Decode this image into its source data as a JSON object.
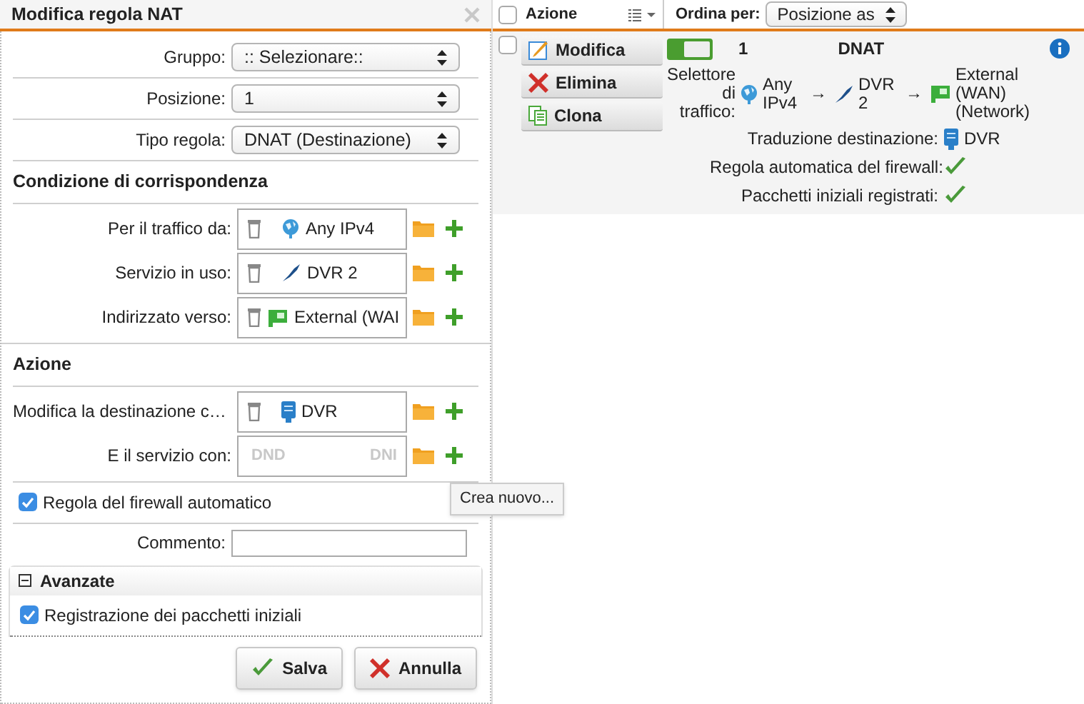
{
  "dialog": {
    "title": "Modifica regola NAT",
    "selects": [
      {
        "label": "Gruppo:",
        "value": ":: Selezionare::"
      },
      {
        "label": "Posizione:",
        "value": "1"
      },
      {
        "label": "Tipo regola:",
        "value": "DNAT (Destinazione)"
      }
    ],
    "match_section": {
      "title": "Condizione di corrispondenza",
      "rows": [
        {
          "label": "Per il traffico da:",
          "item": "Any IPv4",
          "kind": "network"
        },
        {
          "label": "Servizio in uso:",
          "item": "DVR 2",
          "kind": "service"
        },
        {
          "label": "Indirizzato verso:",
          "item": "External (WAI",
          "kind": "interface"
        }
      ]
    },
    "action_section": {
      "title": "Azione",
      "rows": [
        {
          "label": "Modifica la destinazione c…",
          "item": "DVR",
          "kind": "host"
        },
        {
          "label": "E il servizio con:",
          "hints": [
            "DND",
            "DNI"
          ],
          "kind": "empty"
        }
      ]
    },
    "auto_firewall": {
      "label": "Regola del firewall automatico",
      "checked": true
    },
    "comment": {
      "label": "Commento:"
    },
    "advanced": {
      "title": "Avanzate",
      "expanded": true,
      "log": {
        "label": "Registrazione dei pacchetti iniziali",
        "checked": true
      }
    },
    "buttons": [
      {
        "label": "Salva",
        "kind": "save"
      },
      {
        "label": "Annulla",
        "kind": "cancel"
      }
    ]
  },
  "tooltip": "Crea nuovo...",
  "list": {
    "header": {
      "action": "Azione",
      "sort_label": "Ordina per:",
      "sort_value": "Posizione as",
      "checked": false
    },
    "rules": [
      {
        "checked": false,
        "enabled": true,
        "number": "1",
        "type": "DNAT",
        "buttons": [
          {
            "label": "Modifica",
            "kind": "edit"
          },
          {
            "label": "Elimina",
            "kind": "delete"
          },
          {
            "label": "Clona",
            "kind": "clone"
          }
        ],
        "selector_label": "Selettore di traffico:",
        "separator": "→",
        "chain": [
          {
            "text": "Any IPv4",
            "kind": "network"
          },
          {
            "text": "DVR 2",
            "kind": "service"
          },
          {
            "text": "External (WAN) (Network)",
            "kind": "interface"
          }
        ],
        "translation": {
          "label": "Traduzione destinazione:",
          "item": "DVR",
          "kind": "host"
        },
        "flags": [
          {
            "label": "Regola automatica del firewall:",
            "value": true
          },
          {
            "label": "Pacchetti iniziali registrati:",
            "value": true
          }
        ]
      }
    ]
  }
}
